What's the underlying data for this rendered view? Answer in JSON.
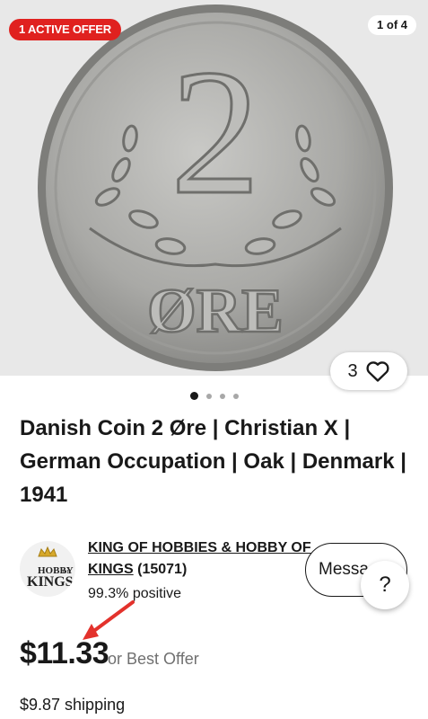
{
  "hero": {
    "badge": "1 ACTIVE OFFER",
    "counter": "1 of 4",
    "watch_count": "3",
    "coin_numeral": "2",
    "coin_word": "ØRE",
    "dots": [
      true,
      false,
      false,
      false
    ]
  },
  "listing": {
    "title": "Danish Coin 2 Øre | Christian X | German Occupation | Oak | Denmark | 1941"
  },
  "seller": {
    "logo_line1": "HOBBY",
    "logo_of": "OF",
    "logo_line2": "KINGS",
    "name": "KING OF HOBBIES & HOBBY OF KINGS",
    "reviews": "(15071)",
    "feedback": "99.3% positive",
    "message_label": "Message",
    "help_label": "?"
  },
  "pricing": {
    "price": "$11.33",
    "offer_text": "or Best Offer",
    "shipping": "$9.87 shipping"
  },
  "colors": {
    "badge": "#e0211f",
    "annotation_arrow": "#e3322c"
  }
}
